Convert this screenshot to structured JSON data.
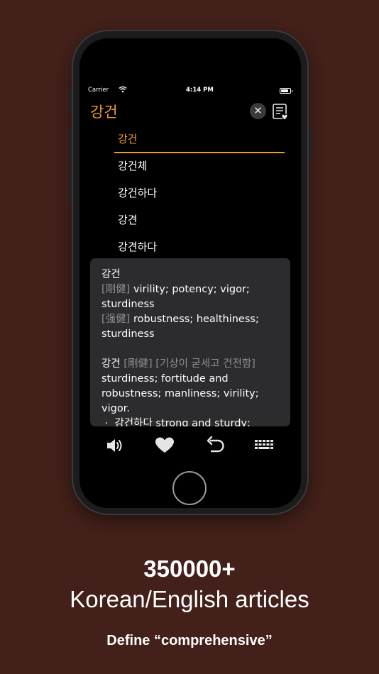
{
  "status_bar": {
    "carrier": "Carrier",
    "time": "4:14 PM"
  },
  "header": {
    "search_word": "강건"
  },
  "suggestions": [
    {
      "label": "강건"
    },
    {
      "label": "강건체"
    },
    {
      "label": "강건하다"
    },
    {
      "label": "강견"
    },
    {
      "label": "강견하다"
    }
  ],
  "definition": {
    "entry1": {
      "headword": "강건",
      "sense1_hanja": "[剛健]",
      "sense1_text": "virility; potency; vigor; sturdiness",
      "sense2_hanja": "[强健]",
      "sense2_text": "robustness; healthiness; sturdiness"
    },
    "entry2": {
      "headword": "강건",
      "hanja": "[剛健]",
      "gloss": "[기상이 굳세고 건전함]",
      "text": "sturdiness; fortitude and robustness; manliness; virility; vigor.",
      "bullet": "·",
      "example_word": "강건하다",
      "example_text": "strong and sturdy; virile;"
    }
  },
  "toolbar": {
    "icons": [
      "speaker-icon",
      "heart-icon",
      "undo-icon",
      "keyboard-icon"
    ]
  },
  "caption": {
    "line1": "350000+",
    "line2": "Korean/English articles",
    "subtitle": "Define “comprehensive”"
  },
  "colors": {
    "accent": "#f09a2e",
    "background": "#43201a",
    "card": "#2c2c2e"
  }
}
